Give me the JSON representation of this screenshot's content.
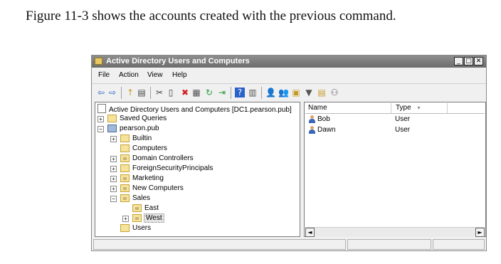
{
  "caption": "Figure 11-3 shows the accounts created with the previous command.",
  "window": {
    "title": "Active Directory Users and Computers",
    "controls": {
      "minimize": "_",
      "maximize": "□",
      "close": "✕"
    }
  },
  "menu": [
    "File",
    "Action",
    "View",
    "Help"
  ],
  "toolbar_icons": [
    "back-arrow-icon",
    "forward-arrow-icon",
    "up-folder-icon",
    "show-hide-tree-icon",
    "cut-icon",
    "copy-icon",
    "delete-icon",
    "properties-icon",
    "refresh-icon",
    "export-icon",
    "help-icon",
    "view-icon",
    "create-user-icon",
    "create-group-icon",
    "create-ou-icon",
    "filter-icon",
    "find-icon",
    "add-to-group-icon"
  ],
  "tree": {
    "root": "Active Directory Users and Computers [DC1.pearson.pub]",
    "items": [
      {
        "label": "Saved Queries",
        "expander": "+"
      },
      {
        "label": "pearson.pub",
        "expander": "−"
      },
      {
        "label": "Builtin",
        "expander": "+"
      },
      {
        "label": "Computers",
        "expander": ""
      },
      {
        "label": "Domain Controllers",
        "expander": "+"
      },
      {
        "label": "ForeignSecurityPrincipals",
        "expander": "+"
      },
      {
        "label": "Marketing",
        "expander": "+"
      },
      {
        "label": "New Computers",
        "expander": "+"
      },
      {
        "label": "Sales",
        "expander": "−"
      },
      {
        "label": "East",
        "expander": ""
      },
      {
        "label": "West",
        "expander": "+"
      },
      {
        "label": "Users",
        "expander": ""
      }
    ]
  },
  "list": {
    "columns": {
      "name": "Name",
      "type": "Type",
      "sort_glyph": "▾"
    },
    "rows": [
      {
        "name": "Bob",
        "type": "User"
      },
      {
        "name": "Dawn",
        "type": "User"
      }
    ]
  },
  "scroll": {
    "left": "◄",
    "right": "►"
  },
  "toolbar_glyphs": {
    "back": "⇦",
    "forward": "⇨",
    "up": "↑",
    "tree": "▤",
    "cut": "✂",
    "copy": "▯",
    "delete": "✖",
    "props": "▦",
    "refresh": "↻",
    "export": "⇥",
    "help": "?",
    "view": "▥",
    "user": "👤",
    "group": "👥",
    "ou": "▣",
    "filter": "▼",
    "find": "▤",
    "addgroup": "⚇"
  }
}
